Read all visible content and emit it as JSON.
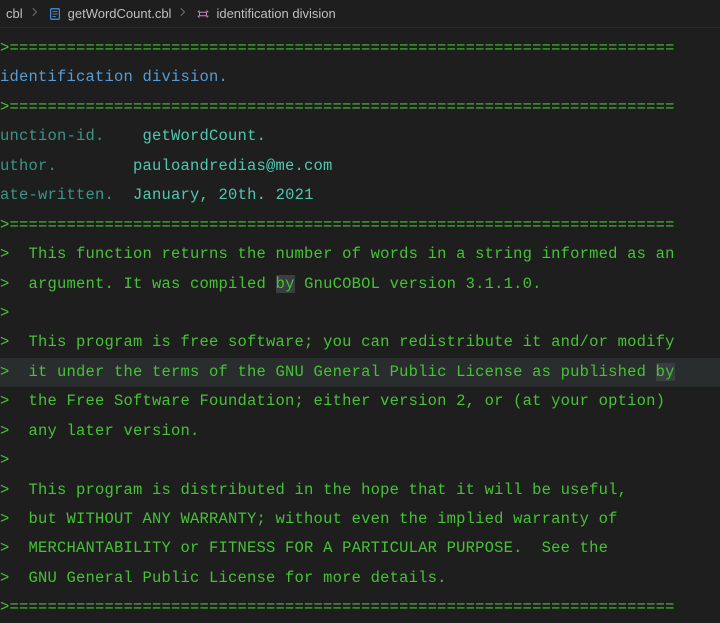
{
  "breadcrumb": {
    "prefix": "cbl",
    "file": "getWordCount.cbl",
    "symbol": "identification division"
  },
  "code": {
    "rule": ">======================================================================",
    "identDiv": "identification division.",
    "funcKey": "unction-id.",
    "funcVal": "getWordCount.",
    "authorKey": "uthor.",
    "authorVal": "pauloandredias@me.com",
    "dateKey": "ate-written.",
    "dateVal": "January, 20th. 2021",
    "gt": "> ",
    "c1": " This function returns the number of words in a string informed as an",
    "c2a": " argument. It was compiled ",
    "c2by": "by",
    "c2b": " GnuCOBOL version 3.1.1.0.",
    "c3": " This program is free software; you can redistribute it and/or modify",
    "c4a": " it under the terms of the GNU General Public License as published ",
    "c4by": "by",
    "c5": " the Free Software Foundation; either version 2, or (at your option)",
    "c6": " any later version.",
    "c7": " This program is distributed in the hope that it will be useful,",
    "c8": " but WITHOUT ANY WARRANTY; without even the implied warranty of",
    "c9": " MERCHANTABILITY or FITNESS FOR A PARTICULAR PURPOSE.  See the",
    "c10": " GNU General Public License for more details."
  }
}
